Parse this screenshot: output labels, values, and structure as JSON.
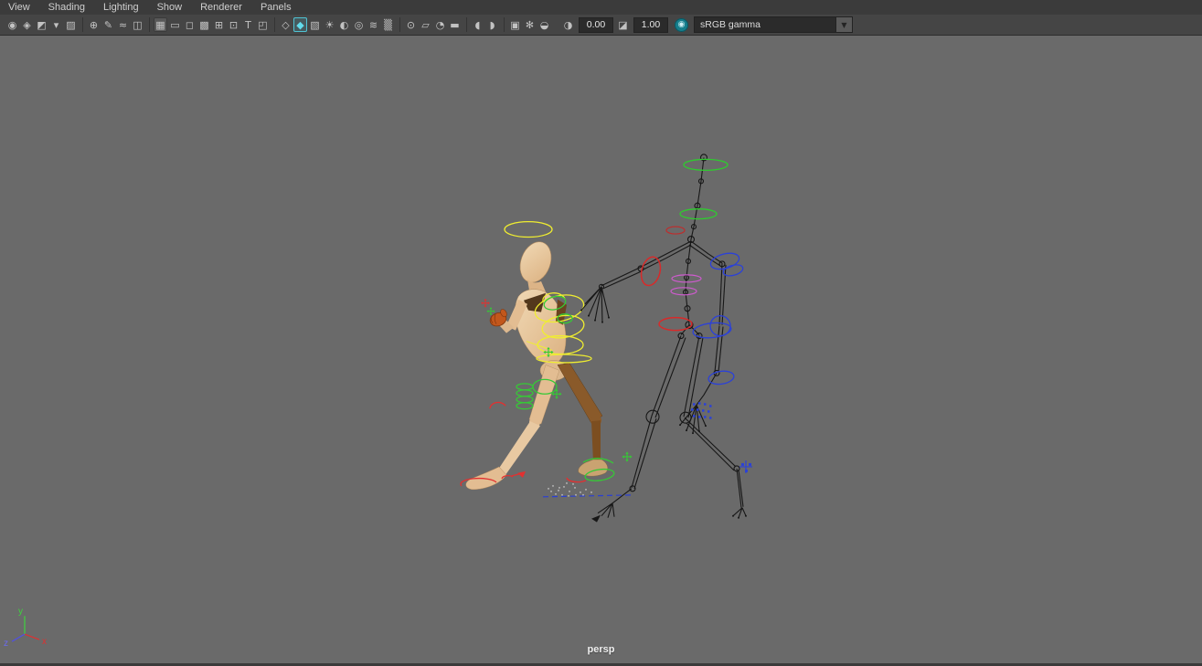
{
  "menubar": {
    "items": [
      {
        "label": "View"
      },
      {
        "label": "Shading"
      },
      {
        "label": "Lighting"
      },
      {
        "label": "Show"
      },
      {
        "label": "Renderer"
      },
      {
        "label": "Panels"
      }
    ]
  },
  "toolbar": {
    "icons": [
      {
        "name": "select-camera-icon",
        "glyph": "◉"
      },
      {
        "name": "lock-camera-icon",
        "glyph": "◈"
      },
      {
        "name": "camera-attributes-icon",
        "glyph": "◩"
      },
      {
        "name": "bookmark-icon",
        "glyph": "▾"
      },
      {
        "name": "image-plane-icon",
        "glyph": "▨"
      },
      {
        "name": "two-d-pan-zoom-icon",
        "glyph": "⊕"
      },
      {
        "name": "grease-pencil-icon",
        "glyph": "✎"
      },
      {
        "name": "camera-shake-icon",
        "glyph": "≈"
      },
      {
        "name": "multi-camera-icon",
        "glyph": "◫"
      },
      {
        "name": "grid-icon",
        "glyph": "▦",
        "pressed": true
      },
      {
        "name": "film-gate-icon",
        "glyph": "▭"
      },
      {
        "name": "resolution-gate-icon",
        "glyph": "◻"
      },
      {
        "name": "gate-mask-icon",
        "glyph": "▩"
      },
      {
        "name": "field-chart-icon",
        "glyph": "⊞"
      },
      {
        "name": "safe-action-icon",
        "glyph": "⊡"
      },
      {
        "name": "safe-title-icon",
        "glyph": "T"
      },
      {
        "name": "hud-icon",
        "glyph": "◰"
      },
      {
        "name": "wireframe-icon",
        "glyph": "◇"
      },
      {
        "name": "smooth-shade-icon",
        "glyph": "◆",
        "active": true
      },
      {
        "name": "textured-icon",
        "glyph": "▧"
      },
      {
        "name": "use-all-lights-icon",
        "glyph": "☀"
      },
      {
        "name": "shadows-icon",
        "glyph": "◐"
      },
      {
        "name": "occlusion-icon",
        "glyph": "◎"
      },
      {
        "name": "motion-blur-icon",
        "glyph": "≋"
      },
      {
        "name": "multisample-icon",
        "glyph": "▒"
      },
      {
        "name": "isolate-select-icon",
        "glyph": "⊙"
      },
      {
        "name": "xray-icon",
        "glyph": "▱"
      },
      {
        "name": "xray-joints-icon",
        "glyph": "◔"
      },
      {
        "name": "image-plane-display-icon",
        "glyph": "▬"
      },
      {
        "name": "gpu-cache-icon",
        "glyph": "◖"
      },
      {
        "name": "plugin-shapes-icon",
        "glyph": "◗"
      },
      {
        "name": "scene-assembly-icon",
        "glyph": "▣"
      },
      {
        "name": "paint-effects-icon",
        "glyph": "✻"
      },
      {
        "name": "stereo-icon",
        "glyph": "◒"
      },
      {
        "name": "exposure-icon",
        "glyph": "◑"
      },
      {
        "name": "gamma-icon",
        "glyph": "◪"
      },
      {
        "name": "color-management-icon",
        "glyph": "◉"
      }
    ],
    "exposure_value": "0.00",
    "gamma_value": "1.00",
    "view_transform": "sRGB gamma",
    "dropdown_arrow_glyph": "▼"
  },
  "viewport": {
    "camera_label": "persp",
    "axis_labels": {
      "x": "x",
      "y": "y",
      "z": "z"
    },
    "background_color": "#6a6a6a"
  },
  "colors": {
    "menubar_bg": "#3b3b3b",
    "toolbar_bg": "#454545",
    "field_bg": "#2b2b2b",
    "active_icon_accent": "#4fc3d4",
    "rig_yellow": "#f0ee30",
    "rig_green": "#36c936",
    "rig_red": "#e23030",
    "rig_blue": "#2b41d8",
    "rig_magenta": "#cf5bcf",
    "skeleton_line": "#171717",
    "skin": "#e6c49c",
    "skin_shadow": "#8a5a2a",
    "glove_orange": "#c2571c"
  }
}
